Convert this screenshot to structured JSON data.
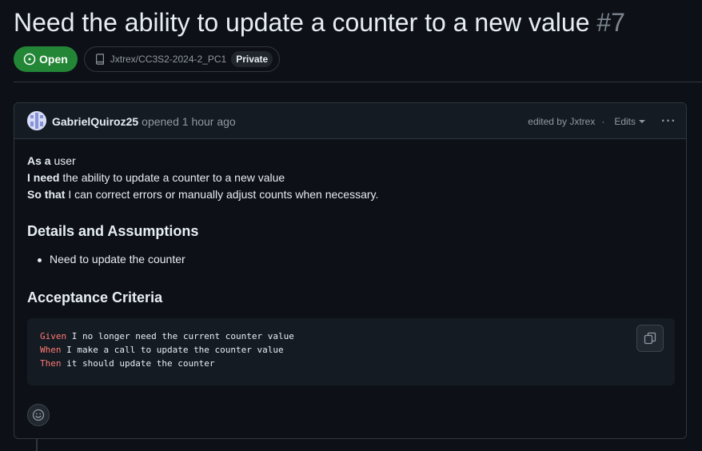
{
  "issue": {
    "title": "Need the ability to update a counter to a new value",
    "number": "#7",
    "state": "Open",
    "repo": "Jxtrex/CC3S2-2024-2_PC1",
    "visibility": "Private"
  },
  "comment": {
    "author": "GabrielQuiroz25",
    "opened_text": "opened 1 hour ago",
    "edited_by": "edited by Jxtrex",
    "separator": "·",
    "edits_label": "Edits",
    "more_label": "···",
    "story": [
      {
        "bold": "As a",
        "text": " user"
      },
      {
        "bold": "I need",
        "text": " the ability to update a counter to a new value"
      },
      {
        "bold": "So that",
        "text": " I can correct errors or manually adjust counts when necessary."
      }
    ],
    "details_heading": "Details and Assumptions",
    "details_items": [
      "Need to update the counter"
    ],
    "criteria_heading": "Acceptance Criteria",
    "code_lines": [
      {
        "kw": "Given",
        "text": " I no longer need the current counter value"
      },
      {
        "kw": "When",
        "text": " I make a call to update the counter value"
      },
      {
        "kw": "Then",
        "text": " it should update the counter"
      }
    ]
  },
  "colors": {
    "open_green": "#238636",
    "keyword": "#ff7b72",
    "background": "#0d1117"
  }
}
